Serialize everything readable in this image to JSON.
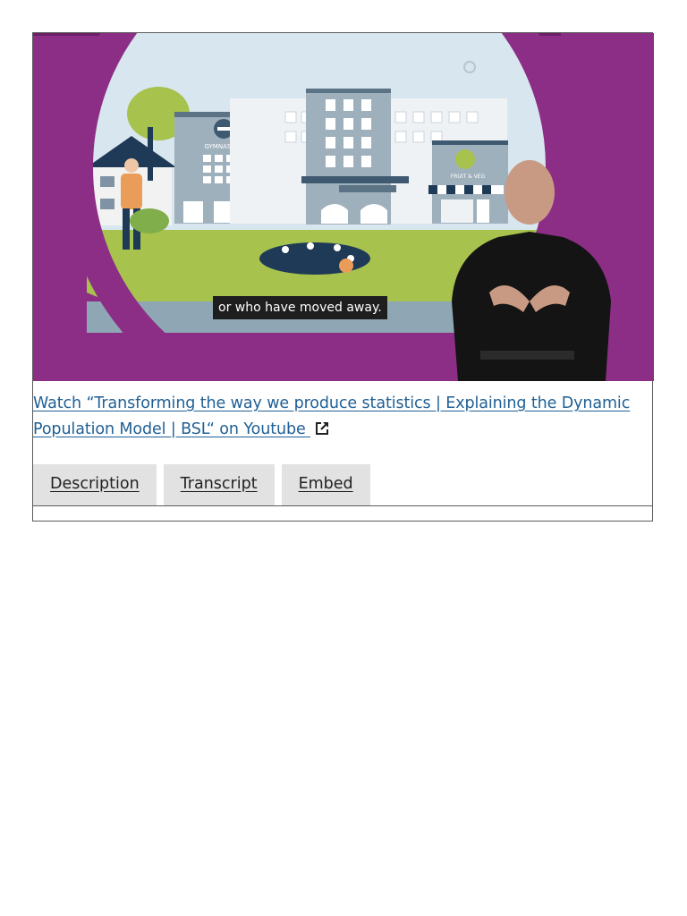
{
  "video": {
    "caption": "or who have moved away.",
    "scene_signs": {
      "gymnasium": "GYMNASIUM",
      "shop": "FRUIT & VEG"
    }
  },
  "link": {
    "text": "Watch “Transforming the way we produce statistics | Explaining the Dynamic Population Model | BSL“ on Youtube ",
    "icon": "external-link-icon",
    "color": "#206095"
  },
  "tabs": [
    {
      "label": "Description"
    },
    {
      "label": "Transcript"
    },
    {
      "label": "Embed"
    }
  ],
  "colors": {
    "frame_purple": "#8d2e86",
    "tab_bg": "#e2e2e3",
    "border": "#5b5b5b"
  }
}
